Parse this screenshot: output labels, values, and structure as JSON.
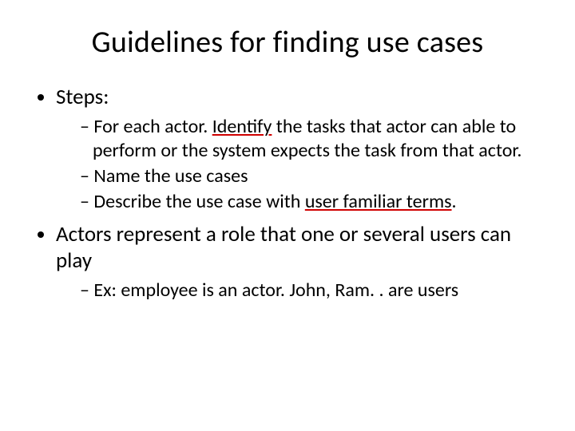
{
  "title": "Guidelines for finding use cases",
  "bullets": {
    "b1": "Steps:",
    "b1_sub": {
      "s1_pre": "For each actor. ",
      "s1_mid": "Identify",
      "s1_post": " the tasks that actor can able to perform or the system expects the task from that actor.",
      "s2": "Name the use cases",
      "s3_pre": "Describe the use case with ",
      "s3_mid": "user familiar terms",
      "s3_post": "."
    },
    "b2": "Actors represent a role that one or several users can play",
    "b2_sub": {
      "s1": "Ex: employee is an actor. John, Ram. . are users"
    }
  }
}
